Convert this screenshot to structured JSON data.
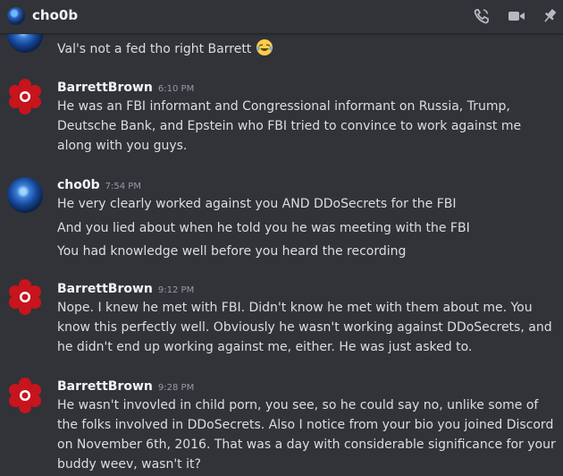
{
  "header": {
    "title": "cho0b",
    "icons": [
      "call-icon",
      "video-icon",
      "pin-icon"
    ]
  },
  "messages": [
    {
      "author": "",
      "time": "",
      "lines": [
        "Val's not a fed tho right Barrett"
      ],
      "emoji": "laughing-crying-emoji"
    },
    {
      "author": "BarrettBrown",
      "time": "6:10 PM",
      "lines": [
        "He was an FBI informant and Congressional informant on Russia, Trump, Deutsche Bank, and Epstein who FBI tried to convince to work against me along with you guys."
      ]
    },
    {
      "author": "cho0b",
      "time": "7:54 PM",
      "lines": [
        "He very clearly worked against you AND DDoSecrets for the FBI",
        "And you lied about when he told you he was meeting with the FBI",
        "You had knowledge well before you heard the recording"
      ]
    },
    {
      "author": "BarrettBrown",
      "time": "9:12 PM",
      "lines": [
        "Nope. I knew he met with FBI. Didn't know he met with them about me. You know this perfectly well. Obviously he wasn't working against DDoSecrets, and he didn't end up working against me, either. He was just asked to."
      ]
    },
    {
      "author": "BarrettBrown",
      "time": "9:28 PM",
      "lines": [
        "He wasn't invovled in child porn, you see, so he could say no, unlike some of the folks involved in DDoSecrets. Also I notice from your bio you joined Discord on November 6th, 2016. That was a day with considerable significance for your buddy weev, wasn't it?"
      ]
    }
  ]
}
